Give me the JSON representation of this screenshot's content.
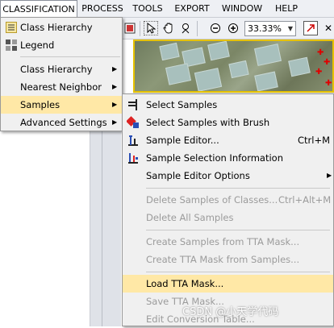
{
  "menubar": {
    "items": [
      {
        "label": "CLASSIFICATION",
        "active": true
      },
      {
        "label": "PROCESS"
      },
      {
        "label": "TOOLS"
      },
      {
        "label": "EXPORT"
      },
      {
        "label": "WINDOW"
      },
      {
        "label": "HELP"
      }
    ]
  },
  "toolbar": {
    "zoom_value": "33.33%",
    "icons": [
      "pointer-icon",
      "hand-pan-icon",
      "magnify-tool-icon",
      "zoom-out-icon",
      "zoom-in-icon",
      "zoom-dropdown-arrow",
      "zoom-fit-icon",
      "close-icon"
    ]
  },
  "classification_menu": {
    "items": [
      {
        "label": "Class Hierarchy",
        "icon": "class-hierarchy-icon",
        "submenu": false
      },
      {
        "label": "Legend",
        "icon": "legend-icon",
        "submenu": false
      },
      {
        "label": "Class Hierarchy",
        "submenu": true
      },
      {
        "label": "Nearest Neighbor",
        "submenu": true
      },
      {
        "label": "Samples",
        "submenu": true,
        "highlighted": true
      },
      {
        "label": "Advanced Settings",
        "submenu": true
      }
    ]
  },
  "samples_menu": {
    "items": [
      {
        "label": "Select Samples",
        "icon": "select-samples-icon"
      },
      {
        "label": "Select Samples with Brush",
        "icon": "brush-icon"
      },
      {
        "label": "Sample Editor...",
        "icon": "sample-editor-icon",
        "shortcut": "Ctrl+M"
      },
      {
        "label": "Sample Selection Information",
        "icon": "selection-info-icon"
      },
      {
        "label": "Sample Editor Options",
        "submenu": true
      },
      {
        "label": "Delete Samples of Classes...",
        "shortcut": "Ctrl+Alt+M",
        "disabled": true
      },
      {
        "label": "Delete All Samples",
        "disabled": true
      },
      {
        "label": "Create Samples from TTA Mask...",
        "disabled": true
      },
      {
        "label": "Create TTA Mask from Samples...",
        "disabled": true
      },
      {
        "label": "Load TTA Mask...",
        "highlighted": true
      },
      {
        "label": "Save TTA Mask...",
        "disabled": true
      },
      {
        "label": "Edit Conversion Table...",
        "disabled": true
      }
    ]
  },
  "watermark": "CSDN @小天学代码",
  "colors": {
    "highlight": "#ffe8a6",
    "menu_bg": "#f0f0f0",
    "disabled_text": "#9b9b9b",
    "image_border": "#e6c200",
    "marker_red": "#e00000"
  }
}
